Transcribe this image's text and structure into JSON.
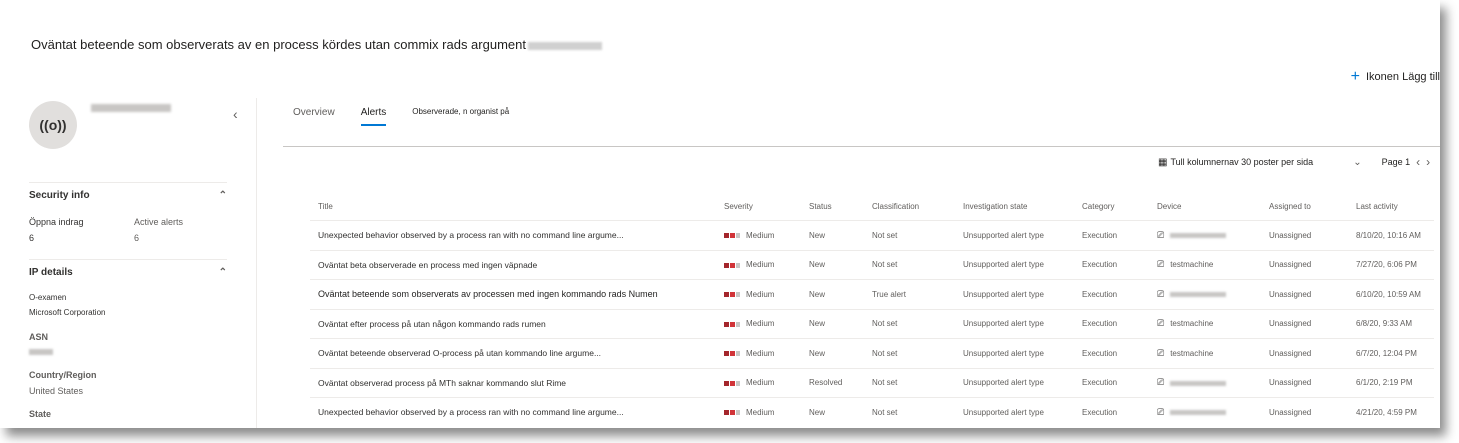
{
  "header": {
    "title": "Oväntat beteende som observerats av en process kördes utan commix rads argument",
    "add_action": "Ikonen Lägg till"
  },
  "entity": {
    "avatar_icon": "((o))"
  },
  "security_info": {
    "heading": "Security info",
    "open_incidents_label": "Öppna indrag",
    "open_incidents_value": "6",
    "active_alerts_label": "Active alerts",
    "active_alerts_value": "6"
  },
  "ip_details": {
    "heading": "IP details",
    "org_label": "O-examen",
    "org_value": "Microsoft Corporation",
    "asn_label": "ASN",
    "country_label": "Country/Region",
    "country_value": "United States",
    "state_label": "State"
  },
  "tabs": [
    {
      "label": "Overview"
    },
    {
      "label": "Alerts"
    },
    {
      "label": "Observerade, n organist på"
    }
  ],
  "toolbar": {
    "columns_label": "Tull kolumnernav 30 poster per sida",
    "page_label": "Page 1"
  },
  "table": {
    "columns": [
      "Title",
      "Severity",
      "Status",
      "Classification",
      "Investigation state",
      "Category",
      "Device",
      "Assigned to",
      "Last activity"
    ],
    "rows": [
      {
        "title": "Unexpected behavior observed by a process ran with no command line argume...",
        "severity": "Medium",
        "status": "New",
        "classification": "Not set",
        "investigation": "Unsupported alert type",
        "category": "Execution",
        "device": "",
        "assigned": "Unassigned",
        "last": "8/10/20, 10:16 AM"
      },
      {
        "title": "Oväntat beta observerade en process med ingen väpnade",
        "severity": "Medium",
        "status": "New",
        "classification": "Not set",
        "investigation": "Unsupported alert type",
        "category": "Execution",
        "device": "testmachine",
        "assigned": "Unassigned",
        "last": "7/27/20, 6:06 PM"
      },
      {
        "title": "Oväntat beteende som observerats av processen med ingen kommando rads Numen",
        "severity": "Medium",
        "status": "New",
        "classification": "True alert",
        "investigation": "Unsupported alert type",
        "category": "Execution",
        "device": "",
        "assigned": "Unassigned",
        "last": "6/10/20, 10:59 AM"
      },
      {
        "title": "Oväntat efter process på utan någon kommando rads rumen",
        "severity": "Medium",
        "status": "New",
        "classification": "Not set",
        "investigation": "Unsupported alert type",
        "category": "Execution",
        "device": "testmachine",
        "assigned": "Unassigned",
        "last": "6/8/20, 9:33 AM"
      },
      {
        "title": "Oväntat beteende observerad O-process på utan kommando        line argume...",
        "severity": "Medium",
        "status": "New",
        "classification": "Not set",
        "investigation": "Unsupported alert type",
        "category": "Execution",
        "device": "testmachine",
        "assigned": "Unassigned",
        "last": "6/7/20, 12:04 PM"
      },
      {
        "title": "Oväntat observerad process på MTh saknar kommando slut Rime",
        "severity": "Medium",
        "status": "Resolved",
        "classification": "Not set",
        "investigation": "Unsupported alert type",
        "category": "Execution",
        "device": "",
        "assigned": "Unassigned",
        "last": "6/1/20, 2:19 PM"
      },
      {
        "title": "Unexpected behavior observed by a process ran with no command line argume...",
        "severity": "Medium",
        "status": "New",
        "classification": "Not set",
        "investigation": "Unsupported alert type",
        "category": "Execution",
        "device": "",
        "assigned": "Unassigned",
        "last": "4/21/20, 4:59 PM"
      }
    ]
  },
  "colors": {
    "accent": "#0078d4",
    "severity_high": "#a4262c",
    "severity_mid": "#d13438"
  }
}
